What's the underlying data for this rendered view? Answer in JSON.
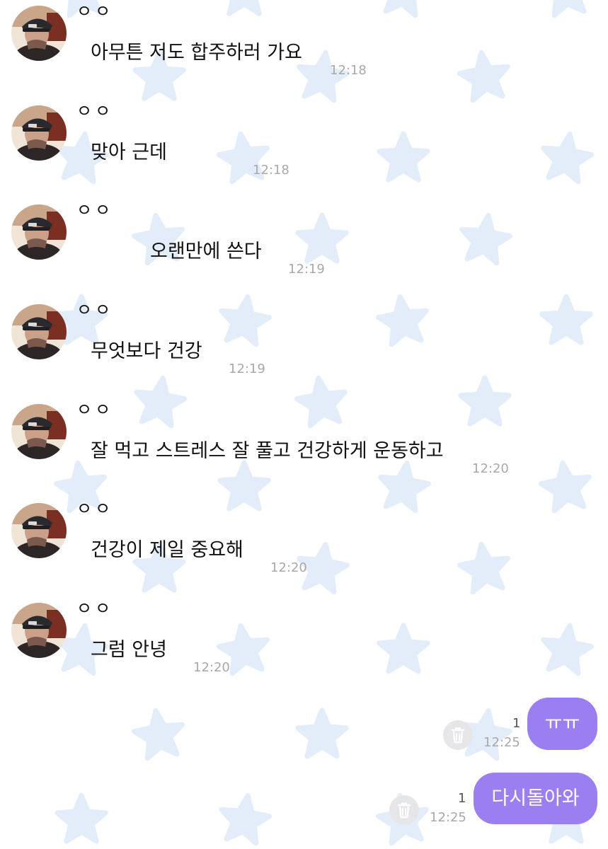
{
  "colors": {
    "background": "#ffffff",
    "star": "#e3edf9",
    "outgoing_bubble": "#9b7ff0",
    "outgoing_text": "#ffffff",
    "incoming_text": "#111111",
    "time_text": "#a9a9a9",
    "trash_button": "#e6e6e8"
  },
  "incoming_messages": [
    {
      "sender": "ㅇㅇ",
      "text": "아무튼 저도 합주하러 가요",
      "time": "12:18"
    },
    {
      "sender": "ㅇㅇ",
      "text": "맞아 근데",
      "time": "12:18"
    },
    {
      "sender": "ㅇㅇ",
      "text": "오랜만에 쓴다",
      "time": "12:19"
    },
    {
      "sender": "ㅇㅇ",
      "text": "무엇보다 건강",
      "time": "12:19"
    },
    {
      "sender": "ㅇㅇ",
      "text": "잘 먹고 스트레스 잘 풀고 건강하게 운동하고",
      "time": "12:20"
    },
    {
      "sender": "ㅇㅇ",
      "text": "건강이 제일 중요해",
      "time": "12:20"
    },
    {
      "sender": "ㅇㅇ",
      "text": "그럼 안녕",
      "time": "12:20"
    }
  ],
  "outgoing_messages": [
    {
      "text": "ㅠㅠ",
      "time": "12:25",
      "unread_count": "1",
      "delete_icon": "trash-icon"
    },
    {
      "text": "다시돌아와",
      "time": "12:25",
      "unread_count": "1",
      "delete_icon": "trash-icon"
    }
  ]
}
